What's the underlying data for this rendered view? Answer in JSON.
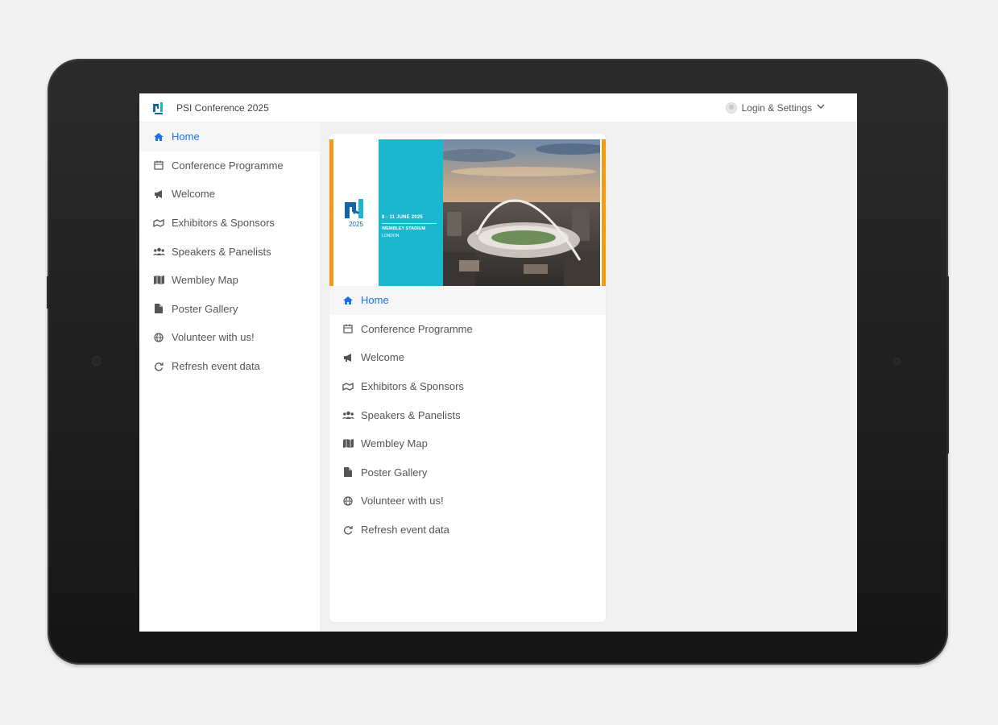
{
  "app": {
    "title": "PSI Conference 2025",
    "login_label": "Login & Settings"
  },
  "nav": [
    {
      "label": "Home",
      "icon": "home-icon",
      "active": true
    },
    {
      "label": "Conference Programme",
      "icon": "calendar-icon"
    },
    {
      "label": "Welcome",
      "icon": "megaphone-icon"
    },
    {
      "label": "Exhibitors & Sponsors",
      "icon": "handshake-icon"
    },
    {
      "label": "Speakers & Panelists",
      "icon": "users-icon"
    },
    {
      "label": "Wembley Map",
      "icon": "map-icon"
    },
    {
      "label": "Poster Gallery",
      "icon": "file-icon"
    },
    {
      "label": "Volunteer with us!",
      "icon": "globe-icon"
    },
    {
      "label": "Refresh event data",
      "icon": "refresh-icon"
    }
  ],
  "banner": {
    "logo_year": "2025",
    "dates": "8 - 11 JUNE 2025",
    "venue": "WEMBLEY STADIUM",
    "city": "LONDON"
  },
  "colors": {
    "accent": "#1a73e8",
    "banner_teal": "#1ab7cf",
    "banner_border": "#f39c12"
  }
}
